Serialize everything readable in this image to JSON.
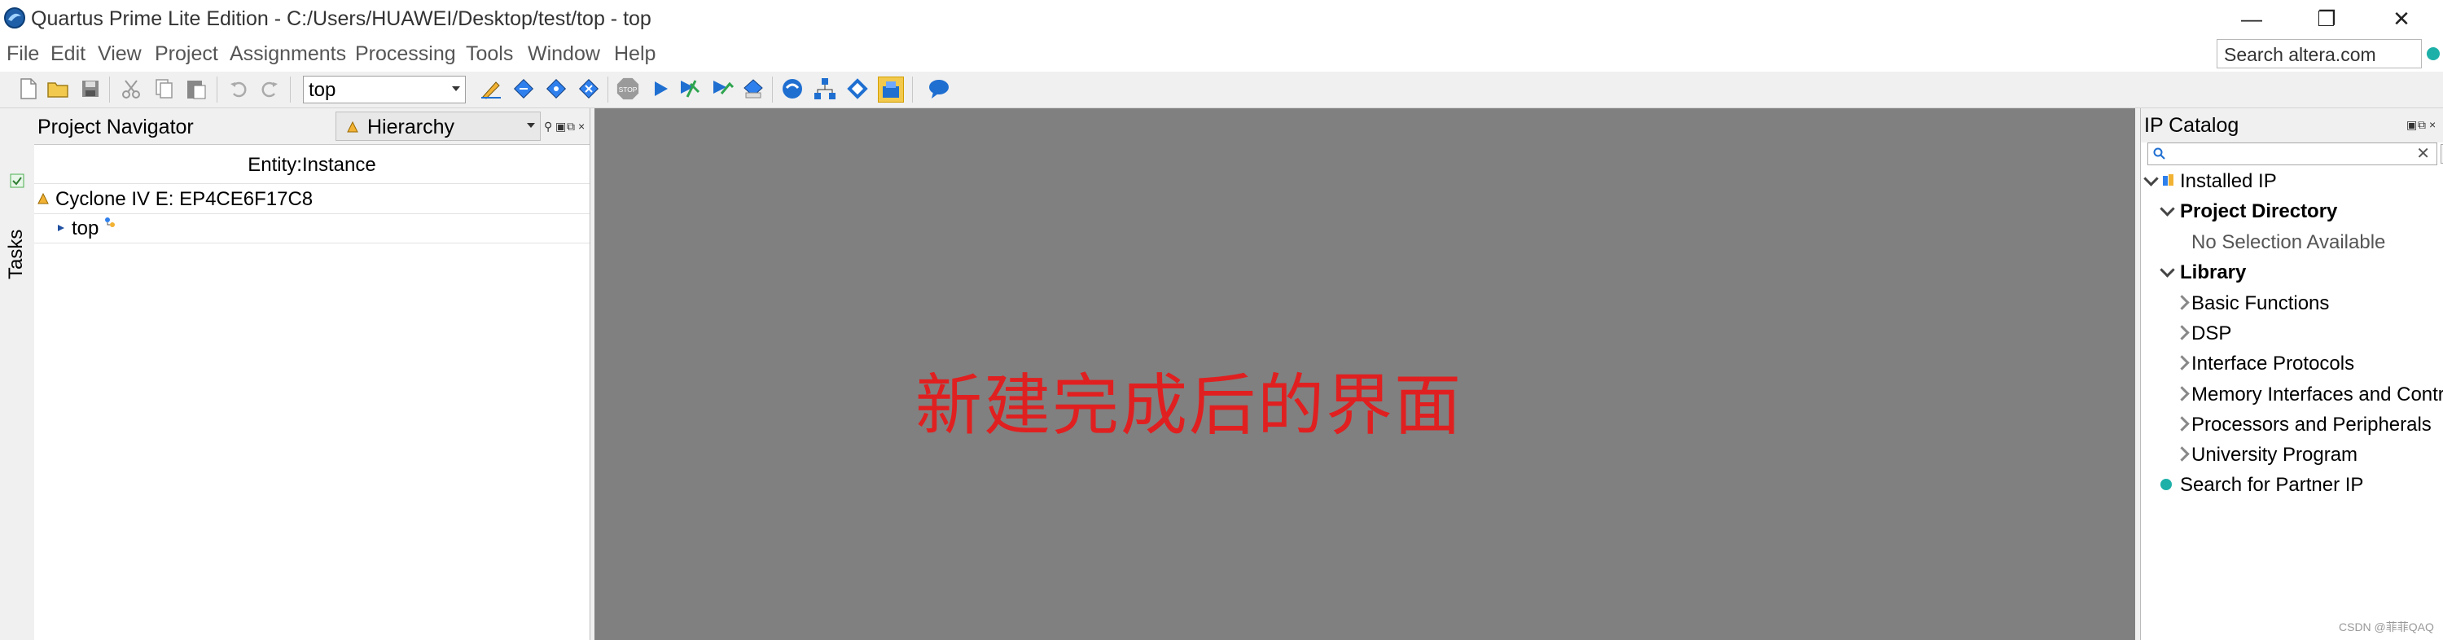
{
  "window": {
    "title": "Quartus Prime Lite Edition - C:/Users/HUAWEI/Desktop/test/top - top",
    "minimize": "—",
    "restore": "❐",
    "close": "✕"
  },
  "menu": {
    "items": [
      "File",
      "Edit",
      "View",
      "Project",
      "Assignments",
      "Processing",
      "Tools",
      "Window",
      "Help"
    ],
    "search_placeholder": "Search altera.com"
  },
  "toolbar": {
    "entity_select_value": "top",
    "icons": [
      "new-file-icon",
      "open-folder-icon",
      "save-icon",
      "cut-icon",
      "copy-icon",
      "paste-icon",
      "undo-icon",
      "redo-icon",
      "assignment-pencil-icon",
      "analysis-icon",
      "synthesis-icon",
      "fitter-icon",
      "stop-icon",
      "start-compilation-icon",
      "assembler-icon",
      "timing-analyzer-icon",
      "eda-netlist-icon",
      "pin-planner-icon",
      "netlist-viewer-icon",
      "chip-planner-icon",
      "programmer-icon",
      "help-bubble-icon"
    ]
  },
  "tasks_strip": {
    "label": "Tasks"
  },
  "project_navigator": {
    "title": "Project Navigator",
    "view_select": "Hierarchy",
    "column_header": "Entity:Instance",
    "device": "Cyclone IV E: EP4CE6F17C8",
    "top_entity": "top"
  },
  "workspace": {
    "annotation": "新建完成后的界面",
    "annotation_color": "#e02020",
    "background_color": "#808080"
  },
  "ip_catalog": {
    "title": "IP Catalog",
    "search_value": "",
    "tree": {
      "installed_ip": "Installed IP",
      "project_directory": "Project Directory",
      "no_selection": "No Selection Available",
      "library": "Library",
      "library_items": [
        "Basic Functions",
        "DSP",
        "Interface Protocols",
        "Memory Interfaces and Controllers",
        "Processors and Peripherals",
        "University Program"
      ],
      "partner": "Search for Partner IP"
    }
  },
  "watermark": "CSDN @菲菲QAQ"
}
